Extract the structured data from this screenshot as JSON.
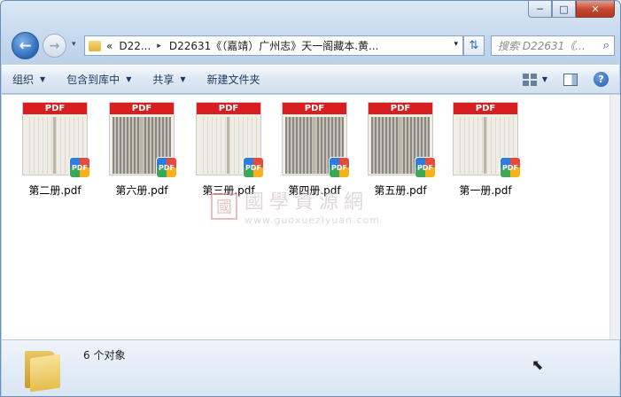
{
  "window": {
    "caption_buttons": {
      "minimize": "─",
      "maximize": "□",
      "close": "✕"
    }
  },
  "nav": {
    "back_glyph": "←",
    "forward_glyph": "→",
    "history_caret": "▾"
  },
  "address": {
    "prefix": "«",
    "segments": [
      "D22...",
      "D22631《（嘉靖）广州志》天一阁藏本.黄..."
    ],
    "separator": "▸",
    "dropdown": "▾"
  },
  "refresh_glyph": "⇅",
  "search": {
    "placeholder": "搜索 D22631《...",
    "icon": "search-icon"
  },
  "toolbar": {
    "organize": "组织",
    "include_library": "包含到库中",
    "share": "共享",
    "new_folder": "新建文件夹",
    "help": "?"
  },
  "files": [
    {
      "name": "第二册.pdf",
      "banner": "PDF",
      "badge": "PDF",
      "tone": "light"
    },
    {
      "name": "第六册.pdf",
      "banner": "PDF",
      "badge": "PDF",
      "tone": "dark"
    },
    {
      "name": "第三册.pdf",
      "banner": "PDF",
      "badge": "PDF",
      "tone": "light"
    },
    {
      "name": "第四册.pdf",
      "banner": "PDF",
      "badge": "PDF",
      "tone": "dark"
    },
    {
      "name": "第五册.pdf",
      "banner": "PDF",
      "badge": "PDF",
      "tone": "dark"
    },
    {
      "name": "第一册.pdf",
      "banner": "PDF",
      "badge": "PDF",
      "tone": "light"
    }
  ],
  "watermark": {
    "seal": "國",
    "cn": "國學資源網",
    "url": "www.guoxueziyuan.com"
  },
  "status": {
    "count": "6 个对象"
  }
}
